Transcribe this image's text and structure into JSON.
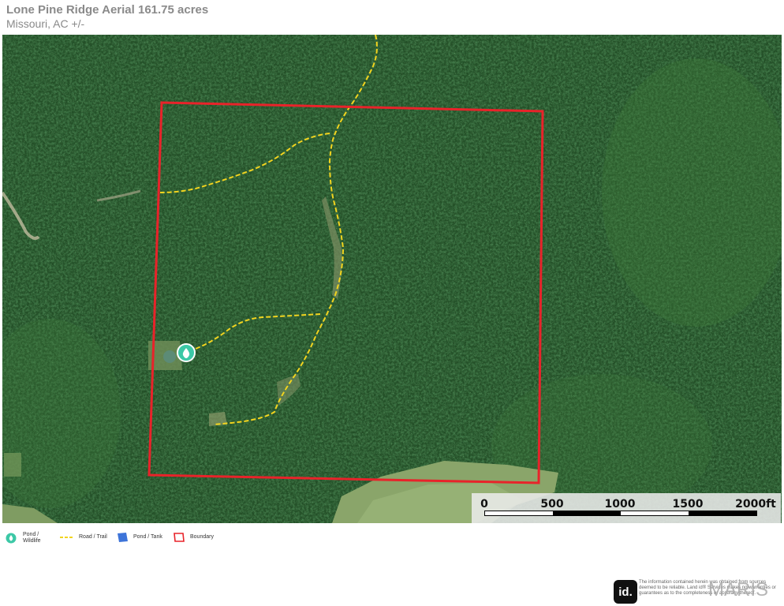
{
  "header": {
    "title": "Lone Pine Ridge Aerial 161.75 acres",
    "subtitle": "Missouri,  AC +/-"
  },
  "colors": {
    "boundary": "#e8232a",
    "trail": "#f2d41f",
    "pond_marker": "#3cc8a6",
    "pond_tank": "#3d74d9",
    "forest": "#22512a"
  },
  "scale": {
    "labels": [
      "0",
      "500",
      "1000",
      "1500",
      "2000ft"
    ]
  },
  "legend": {
    "items": [
      {
        "label_line1": "Pond /",
        "label_line2": "Wildlife",
        "icon": "droplet-marker-icon"
      },
      {
        "label_line1": "Road / Trail",
        "label_line2": "",
        "icon": "dashed-line-icon"
      },
      {
        "label_line1": "Pond / Tank",
        "label_line2": "",
        "icon": "polygon-icon"
      },
      {
        "label_line1": "Boundary",
        "label_line2": "",
        "icon": "boundary-outline-icon"
      }
    ]
  },
  "footer": {
    "logo_text": "id.",
    "disclaimer": "The information contained herein was obtained from sources deemed to be reliable. Land id® Services makes no warranties or guarantees as to the completeness or accuracy thereof.",
    "watermark": "MARIS"
  }
}
